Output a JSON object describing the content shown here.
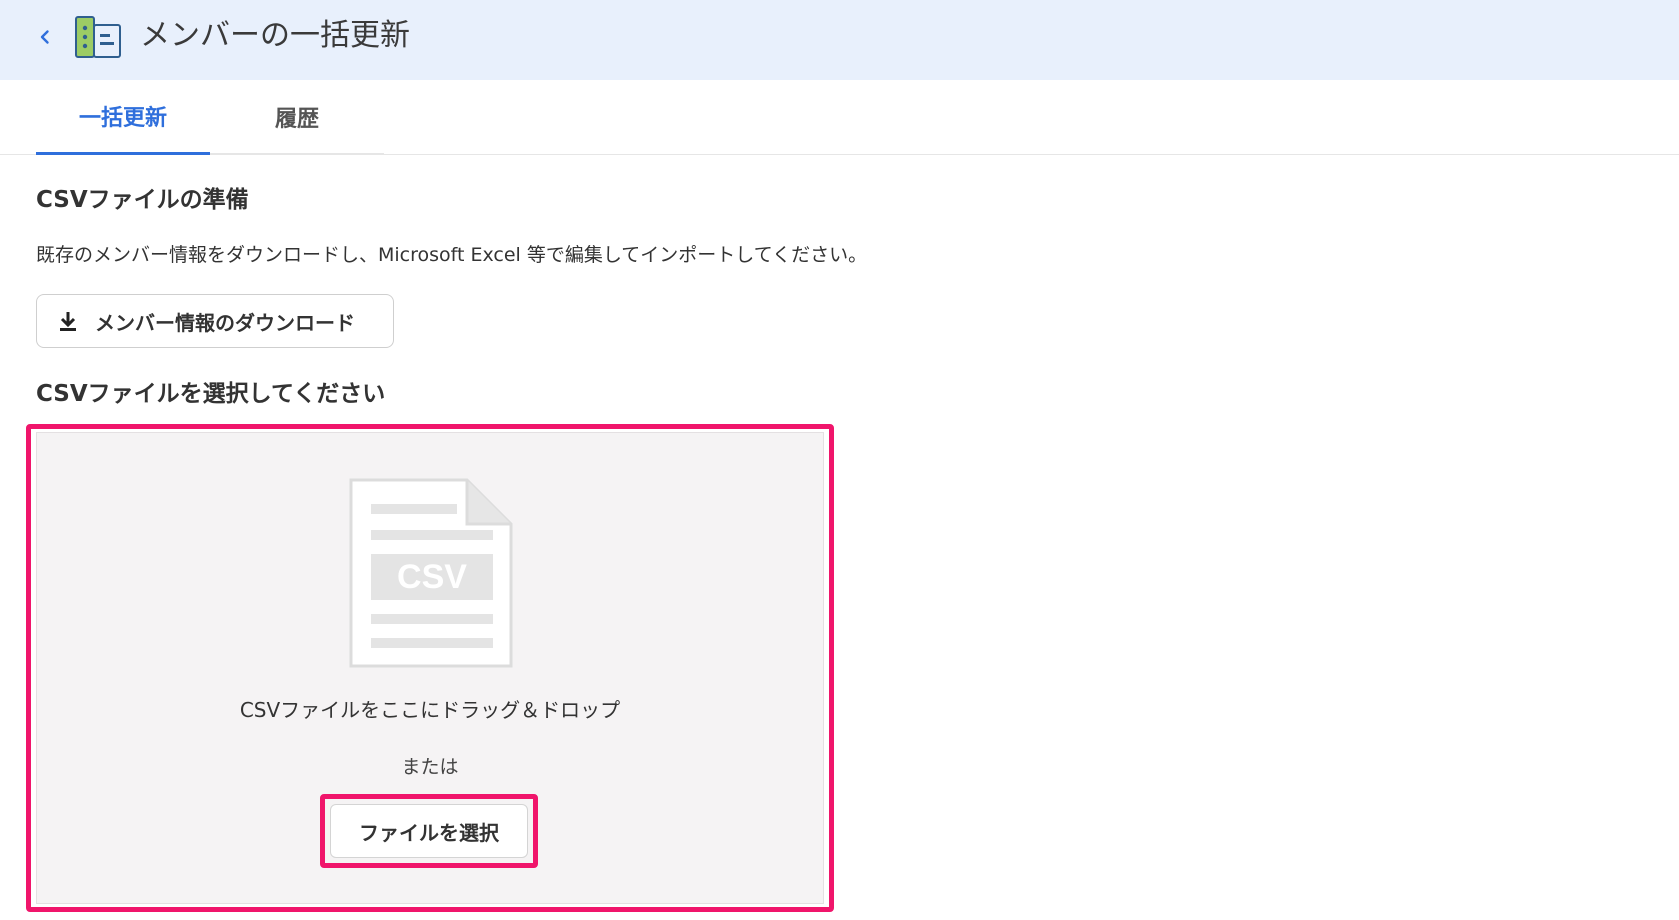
{
  "header": {
    "title": "メンバーの一括更新",
    "back_icon": "chevron-left-icon",
    "app_icon": "member-list-icon"
  },
  "tabs": [
    {
      "label": "一括更新",
      "active": true
    },
    {
      "label": "履歴",
      "active": false
    }
  ],
  "prepare": {
    "title": "CSVファイルの準備",
    "description": "既存のメンバー情報をダウンロードし、Microsoft Excel 等で編集してインポートしてください。",
    "download_label": "メンバー情報のダウンロード",
    "download_icon": "download-icon"
  },
  "select": {
    "title": "CSVファイルを選択してください",
    "file_icon_text": "CSV",
    "drag_text": "CSVファイルをここにドラッグ＆ドロップ",
    "or_text": "または",
    "button_label": "ファイルを選択"
  },
  "colors": {
    "accent": "#2f6fdc",
    "highlight": "#f0156b",
    "header_bg": "#e8f0fc",
    "dropzone_bg": "#f5f3f4"
  }
}
